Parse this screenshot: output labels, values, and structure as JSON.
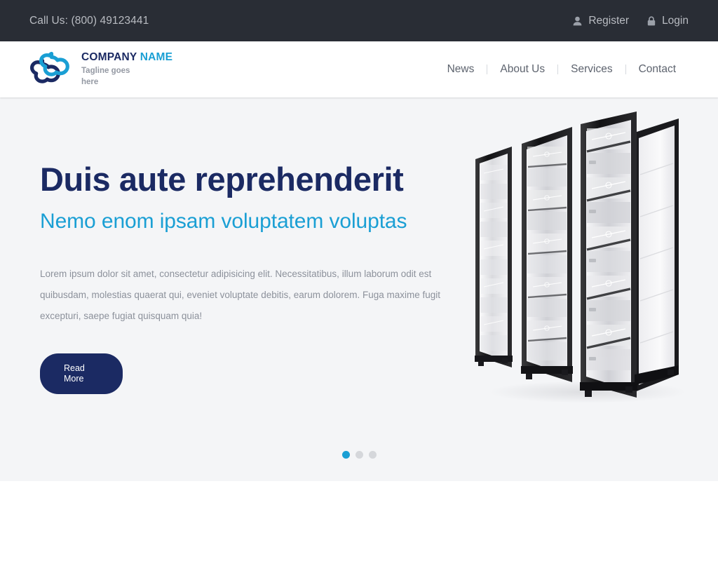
{
  "topbar": {
    "phone_label": "Call Us: (800) 49123441",
    "links": [
      {
        "label": "Register",
        "icon": "user-icon"
      },
      {
        "label": "Login",
        "icon": "lock-icon"
      }
    ]
  },
  "header": {
    "brand": {
      "icon": "cloud-logo-icon",
      "name_primary": "COMPANY",
      "name_accent": "NAME",
      "tagline": "Tagline goes here"
    },
    "nav": [
      {
        "label": "News"
      },
      {
        "label": "About Us"
      },
      {
        "label": "Services"
      },
      {
        "label": "Contact"
      }
    ]
  },
  "hero": {
    "title": "Duis aute reprehenderit",
    "subtitle": "Nemo enom ipsam voluptatem voluptas",
    "paragraph": "Lorem ipsum dolor sit amet, consectetur adipisicing elit. Necessitatibus, illum laborum odit est quibusdam, molestias quaerat qui, eveniet voluptate debitis, earum dolorem. Fuga maxime fugit excepturi, saepe fugiat quisquam quia!",
    "button_line1": "Read",
    "button_line2": "More",
    "image_alt": "server-rack-image",
    "carousel": {
      "slides": 3,
      "active_index": 0
    }
  },
  "colors": {
    "topbar_bg": "#292d35",
    "brand_navy": "#1b2a63",
    "accent_cyan": "#1a9fd4",
    "hero_bg": "#f4f5f7",
    "muted_text": "#8c919b"
  }
}
